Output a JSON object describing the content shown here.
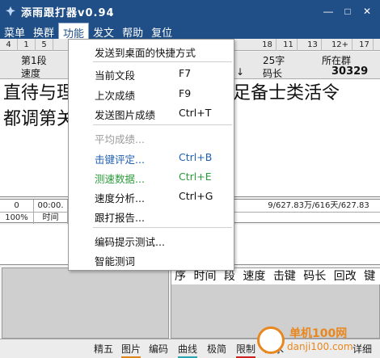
{
  "window": {
    "title": "添雨跟打器v0.94",
    "controls": [
      "—",
      "□",
      "✕"
    ]
  },
  "menubar": [
    "菜单",
    "换群",
    "功能",
    "发文",
    "帮助",
    "复位"
  ],
  "counter_row": [
    "4",
    "1",
    "5",
    "18",
    "11",
    "13",
    "12+",
    "17"
  ],
  "status": {
    "segment": "第1段",
    "speed_label": "速度",
    "char_count": "25字",
    "group_label": "所在群",
    "code_len_label": "码长",
    "group_value": "30329",
    "arrow": "↓"
  },
  "article_lines": [
    "直待与理",
    "足备士类活令",
    "都调第关"
  ],
  "stats": {
    "row1": [
      "0",
      "00:00.",
      "9/627.83万/616天/627.83"
    ],
    "row2": [
      "100%",
      "时间"
    ]
  },
  "grid_headers": [
    "序",
    "时间",
    "段",
    "速度",
    "击键",
    "码长",
    "回改",
    "键"
  ],
  "bottom_toolbar": [
    "精五",
    "图片",
    "编码",
    "曲线",
    "极简",
    "限制",
    "潜水",
    "详细"
  ],
  "dropdown": {
    "items": [
      {
        "label": "发送到桌面的快捷方式",
        "key": "",
        "state": "normal"
      },
      {
        "label": "当前文段",
        "key": "F7",
        "state": "normal"
      },
      {
        "label": "上次成绩",
        "key": "F9",
        "state": "normal"
      },
      {
        "label": "发送图片成绩",
        "key": "Ctrl+T",
        "state": "normal"
      },
      {
        "label": "平均成绩...",
        "key": "",
        "state": "disabled"
      },
      {
        "label": "击键评定...",
        "key": "Ctrl+B",
        "state": "blue"
      },
      {
        "label": "测速数据...",
        "key": "Ctrl+E",
        "state": "green"
      },
      {
        "label": "速度分析...",
        "key": "Ctrl+G",
        "state": "normal"
      },
      {
        "label": "跟打报告...",
        "key": "",
        "state": "normal"
      },
      {
        "label": "编码提示测试...",
        "key": "",
        "state": "normal"
      },
      {
        "label": "智能测词",
        "key": "",
        "state": "normal"
      }
    ]
  },
  "watermark": {
    "line1": "单机100网",
    "line2": "danji100.com"
  },
  "colors": {
    "titlebar": "#1f4f86",
    "accent_blue": "#2060b0",
    "accent_green": "#2a9a3a",
    "watermark_orange": "#e8871e"
  }
}
